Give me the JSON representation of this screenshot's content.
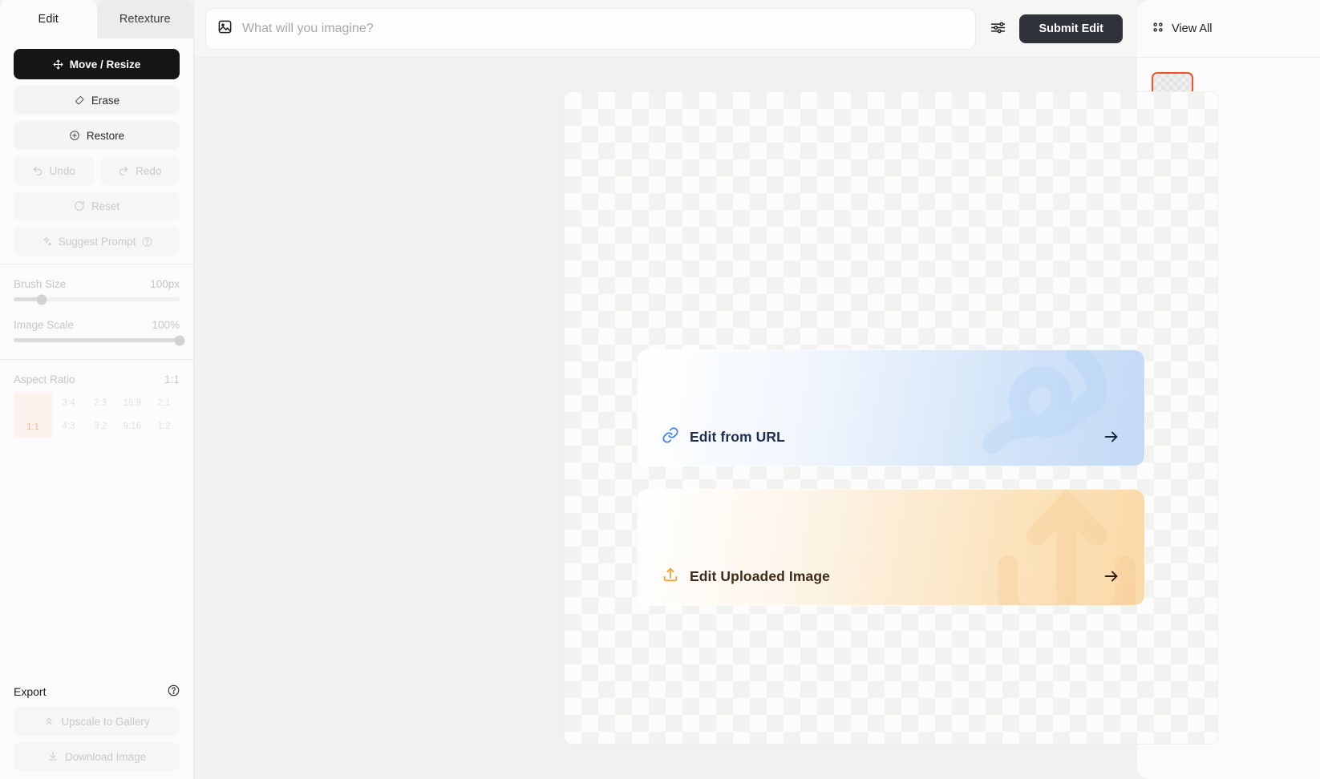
{
  "sidebar": {
    "tabs": [
      {
        "label": "Edit",
        "active": true
      },
      {
        "label": "Retexture",
        "active": false
      }
    ],
    "tools": [
      {
        "label": "Move / Resize",
        "icon": "move-icon",
        "state": "active"
      },
      {
        "label": "Erase",
        "icon": "eraser-icon",
        "state": "normal"
      },
      {
        "label": "Restore",
        "icon": "restore-icon",
        "state": "normal"
      }
    ],
    "history": [
      {
        "label": "Undo",
        "icon": "undo-arrow-icon",
        "state": "disabled"
      },
      {
        "label": "Redo",
        "icon": "redo-arrow-icon",
        "state": "disabled"
      }
    ],
    "reset": {
      "label": "Reset",
      "icon": "refresh-icon",
      "state": "disabled"
    },
    "suggest": {
      "label": "Suggest Prompt",
      "icon": "sparkle-icon",
      "help_icon": "help-circle-icon",
      "state": "disabled"
    },
    "brush": {
      "label": "Brush Size",
      "value": "100px",
      "percent": 17
    },
    "scale": {
      "label": "Image Scale",
      "value": "100%",
      "percent": 100
    },
    "aspect": {
      "label": "Aspect Ratio",
      "value": "1:1",
      "selected": "1:1",
      "options_row1": [
        "3:4",
        "2:3",
        "16:9",
        "2:1"
      ],
      "options_row2": [
        "4:3",
        "3:2",
        "9:16",
        "1:2"
      ]
    },
    "export": {
      "title": "Export",
      "help_icon": "help-circle-icon",
      "buttons": [
        {
          "label": "Upscale to Gallery",
          "icon": "chevrons-up-icon",
          "state": "disabled"
        },
        {
          "label": "Download Image",
          "icon": "download-icon",
          "state": "disabled"
        }
      ]
    }
  },
  "topbar": {
    "image_icon": "image-icon",
    "prompt_placeholder": "What will you imagine?",
    "prompt_value": "",
    "settings_icon": "sliders-icon",
    "submit_label": "Submit Edit"
  },
  "canvas": {
    "cards": [
      {
        "label": "Edit from URL",
        "icon": "link-icon",
        "arrow_icon": "arrow-right-icon",
        "accent": "#3b82f6",
        "theme": "blue"
      },
      {
        "label": "Edit Uploaded Image",
        "icon": "upload-icon",
        "arrow_icon": "arrow-right-icon",
        "accent": "#f0a02a",
        "theme": "amber"
      }
    ]
  },
  "right_panel": {
    "view_all_label": "View All",
    "grid_icon": "grid-icon",
    "thumbnails": [
      {
        "name": "transparent-thumbnail",
        "selected": true,
        "border_color": "#f2542a"
      }
    ]
  }
}
